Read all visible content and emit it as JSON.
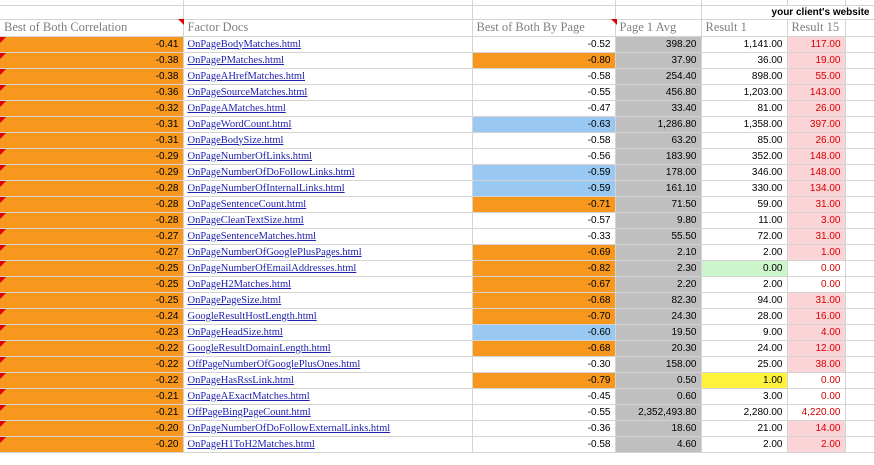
{
  "header_note": "your client's website",
  "columns": [
    "Best of Both Correlation",
    "Factor Docs",
    "Best of Both By Page",
    "Page 1 Avg",
    "Result 1",
    "Result 15"
  ],
  "colors": {
    "orange": "#f7971d",
    "blue": "#99c8f2",
    "gray": "#bfbfbf",
    "pink": "#fbd4d8",
    "red_text": "#d60000",
    "green": "#ccf5cc",
    "yellow": "#fff23a",
    "link": "#1f1fb0"
  },
  "rows": [
    {
      "corr": "-0.41",
      "doc": "OnPageBodyMatches.html",
      "byPage": "-0.52",
      "avg": "398.20",
      "r1": "1,141.00",
      "r15": "117.00"
    },
    {
      "corr": "-0.38",
      "doc": "OnPagePMatches.html",
      "byPage": "-0.80",
      "avg": "37.90",
      "r1": "36.00",
      "r15": "19.00"
    },
    {
      "corr": "-0.38",
      "doc": "OnPageAHrefMatches.html",
      "byPage": "-0.58",
      "avg": "254.40",
      "r1": "898.00",
      "r15": "55.00"
    },
    {
      "corr": "-0.36",
      "doc": "OnPageSourceMatches.html",
      "byPage": "-0.55",
      "avg": "456.80",
      "r1": "1,203.00",
      "r15": "143.00"
    },
    {
      "corr": "-0.32",
      "doc": "OnPageAMatches.html",
      "byPage": "-0.47",
      "avg": "33.40",
      "r1": "81.00",
      "r15": "26.00"
    },
    {
      "corr": "-0.31",
      "doc": "OnPageWordCount.html",
      "byPage": "-0.63",
      "avg": "1,286.80",
      "r1": "1,358.00",
      "r15": "397.00"
    },
    {
      "corr": "-0.31",
      "doc": "OnPageBodySize.html",
      "byPage": "-0.58",
      "avg": "63.20",
      "r1": "85.00",
      "r15": "26.00"
    },
    {
      "corr": "-0.29",
      "doc": "OnPageNumberOfLinks.html",
      "byPage": "-0.56",
      "avg": "183.90",
      "r1": "352.00",
      "r15": "148.00"
    },
    {
      "corr": "-0.29",
      "doc": "OnPageNumberOfDoFollowLinks.html",
      "byPage": "-0.59",
      "avg": "178.00",
      "r1": "346.00",
      "r15": "148.00"
    },
    {
      "corr": "-0.28",
      "doc": "OnPageNumberOfInternalLinks.html",
      "byPage": "-0.59",
      "avg": "161.10",
      "r1": "330.00",
      "r15": "134.00"
    },
    {
      "corr": "-0.28",
      "doc": "OnPageSentenceCount.html",
      "byPage": "-0.71",
      "avg": "71.50",
      "r1": "59.00",
      "r15": "31.00"
    },
    {
      "corr": "-0.28",
      "doc": "OnPageCleanTextSize.html",
      "byPage": "-0.57",
      "avg": "9.80",
      "r1": "11.00",
      "r15": "3.00"
    },
    {
      "corr": "-0.27",
      "doc": "OnPageSentenceMatches.html",
      "byPage": "-0.33",
      "avg": "55.50",
      "r1": "72.00",
      "r15": "31.00"
    },
    {
      "corr": "-0.27",
      "doc": "OnPageNumberOfGooglePlusPages.html",
      "byPage": "-0.69",
      "avg": "2.10",
      "r1": "2.00",
      "r15": "1.00"
    },
    {
      "corr": "-0.25",
      "doc": "OnPageNumberOfEmailAddresses.html",
      "byPage": "-0.82",
      "avg": "2.30",
      "r1": "0.00",
      "r15": "0.00"
    },
    {
      "corr": "-0.25",
      "doc": "OnPageH2Matches.html",
      "byPage": "-0.67",
      "avg": "2.20",
      "r1": "2.00",
      "r15": "0.00"
    },
    {
      "corr": "-0.25",
      "doc": "OnPagePageSize.html",
      "byPage": "-0.68",
      "avg": "82.30",
      "r1": "94.00",
      "r15": "31.00"
    },
    {
      "corr": "-0.24",
      "doc": "GoogleResultHostLength.html",
      "byPage": "-0.70",
      "avg": "24.30",
      "r1": "28.00",
      "r15": "16.00"
    },
    {
      "corr": "-0.23",
      "doc": "OnPageHeadSize.html",
      "byPage": "-0.60",
      "avg": "19.50",
      "r1": "9.00",
      "r15": "4.00"
    },
    {
      "corr": "-0.22",
      "doc": "GoogleResultDomainLength.html",
      "byPage": "-0.68",
      "avg": "20.30",
      "r1": "24.00",
      "r15": "12.00"
    },
    {
      "corr": "-0.22",
      "doc": "OffPageNumberOfGooglePlusOnes.html",
      "byPage": "-0.30",
      "avg": "158.00",
      "r1": "25.00",
      "r15": "38.00"
    },
    {
      "corr": "-0.22",
      "doc": "OnPageHasRssLink.html",
      "byPage": "-0.79",
      "avg": "0.50",
      "r1": "1.00",
      "r15": "0.00"
    },
    {
      "corr": "-0.21",
      "doc": "OnPageAExactMatches.html",
      "byPage": "-0.45",
      "avg": "0.60",
      "r1": "3.00",
      "r15": "0.00"
    },
    {
      "corr": "-0.21",
      "doc": "OffPageBingPageCount.html",
      "byPage": "-0.55",
      "avg": "2,352,493.80",
      "r1": "2,280.00",
      "r15": "4,220.00"
    },
    {
      "corr": "-0.20",
      "doc": "OnPageNumberOfDoFollowExternalLinks.html",
      "byPage": "-0.36",
      "avg": "18.60",
      "r1": "21.00",
      "r15": "14.00"
    },
    {
      "corr": "-0.20",
      "doc": "OnPageH1ToH2Matches.html",
      "byPage": "-0.58",
      "avg": "4.60",
      "r1": "2.00",
      "r15": "2.00"
    }
  ]
}
